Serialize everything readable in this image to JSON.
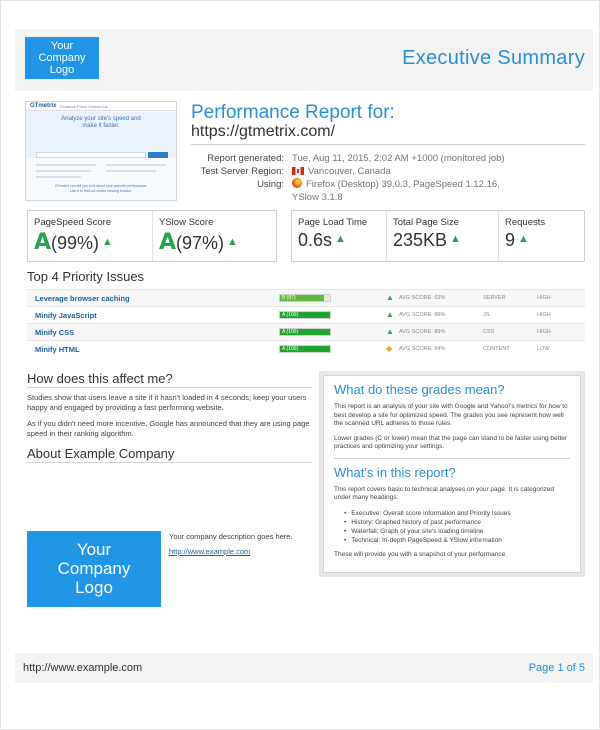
{
  "header": {
    "logo_lines": [
      "Your",
      "Company",
      "Logo"
    ],
    "title": "Executive Summary"
  },
  "thumbnail": {
    "brand": "GTmetrix",
    "nav": "Features  Plans  Contact Us",
    "hero_lines": [
      "Analyze your site's speed and",
      "make it faster."
    ],
    "footer_lines": [
      "GTmetrix can tell you a lot about your website performance.",
      "Use it to find out what's slowing it down."
    ]
  },
  "report": {
    "title": "Performance Report for:",
    "url": "https://gtmetrix.com/",
    "meta": [
      {
        "key": "Report generated:",
        "value": "Tue, Aug 11, 2015, 2:02 AM +1000 (monitored job)"
      },
      {
        "key": "Test Server Region:",
        "value": "Vancouver, Canada"
      },
      {
        "key": "Using:",
        "value": "Firefox (Desktop) 39.0.3, PageSpeed 1.12.16,"
      },
      {
        "key": "",
        "value": "YSlow 3.1.8"
      }
    ]
  },
  "scores": {
    "pagespeed": {
      "label": "PageSpeed Score",
      "grade": "A",
      "value": "(99%)"
    },
    "yslow": {
      "label": "YSlow Score",
      "grade": "A",
      "value": "(97%)"
    },
    "load_time": {
      "label": "Page Load Time",
      "value": "0.6s"
    },
    "page_size": {
      "label": "Total Page Size",
      "value": "235KB"
    },
    "requests": {
      "label": "Requests",
      "value": "9"
    }
  },
  "priority": {
    "title": "Top 4 Priority Issues",
    "issues": [
      {
        "name": "Leverage browser caching",
        "grade": "B (87)",
        "fill": 0.87,
        "avg": "AVG SCORE: 63%",
        "type": "SERVER",
        "priority": "HIGH",
        "icon": "up-arrow-icon",
        "icon_color": "#27a34a"
      },
      {
        "name": "Minify JavaScript",
        "grade": "A (100)",
        "fill": 1.0,
        "avg": "AVG SCORE: 86%",
        "type": "JS",
        "priority": "HIGH",
        "icon": "up-arrow-icon",
        "icon_color": "#27a34a"
      },
      {
        "name": "Minify CSS",
        "grade": "A (100)",
        "fill": 1.0,
        "avg": "AVG SCORE: 89%",
        "type": "CSS",
        "priority": "HIGH",
        "icon": "up-arrow-icon",
        "icon_color": "#27a34a"
      },
      {
        "name": "Minify HTML",
        "grade": "A (100)",
        "fill": 1.0,
        "avg": "AVG SCORE: 94%",
        "type": "CONTENT",
        "priority": "LOW",
        "icon": "diamond-icon",
        "icon_color": "#f0a020"
      }
    ]
  },
  "affect": {
    "title": "How does this affect me?",
    "p1": "Studies show that users leave a site if it hasn't loaded in 4 seconds; keep your users happy and engaged by providing a fast performing website.",
    "p2": "As if you didn't need more incentive, Google has announced that they are using page speed in their ranking algorithm."
  },
  "about": {
    "title": "About Example Company",
    "logo_lines": [
      "Your",
      "Company",
      "Logo"
    ],
    "description": "Your company description goes here.",
    "link": "http://www.example.com"
  },
  "grades": {
    "title": "What do these grades mean?",
    "p1": "This report is an analysis of your site with Google and Yahoo!'s metrics for how to best develop a site for optimized speed. The grades you see represent how well the scanned URL adheres to those rules.",
    "p2": "Lower grades (C or lower) mean that the page can stand to be faster using better practices and optimizing your settings.",
    "report_title": "What's in this report?",
    "p3": "This report covers basic to technical analyses on your page. It is categorized under many headings:",
    "items": [
      "Executive: Overall score information and Priority Issues",
      "History: Graphed history of past performance",
      "Waterfall: Graph of your site's loading timeline",
      "Technical: In-depth PageSpeed & YSlow information"
    ],
    "p4": "These will provide you with a snapshot of your performance."
  },
  "footer": {
    "url": "http://www.example.com",
    "page": "Page 1 of 5"
  }
}
